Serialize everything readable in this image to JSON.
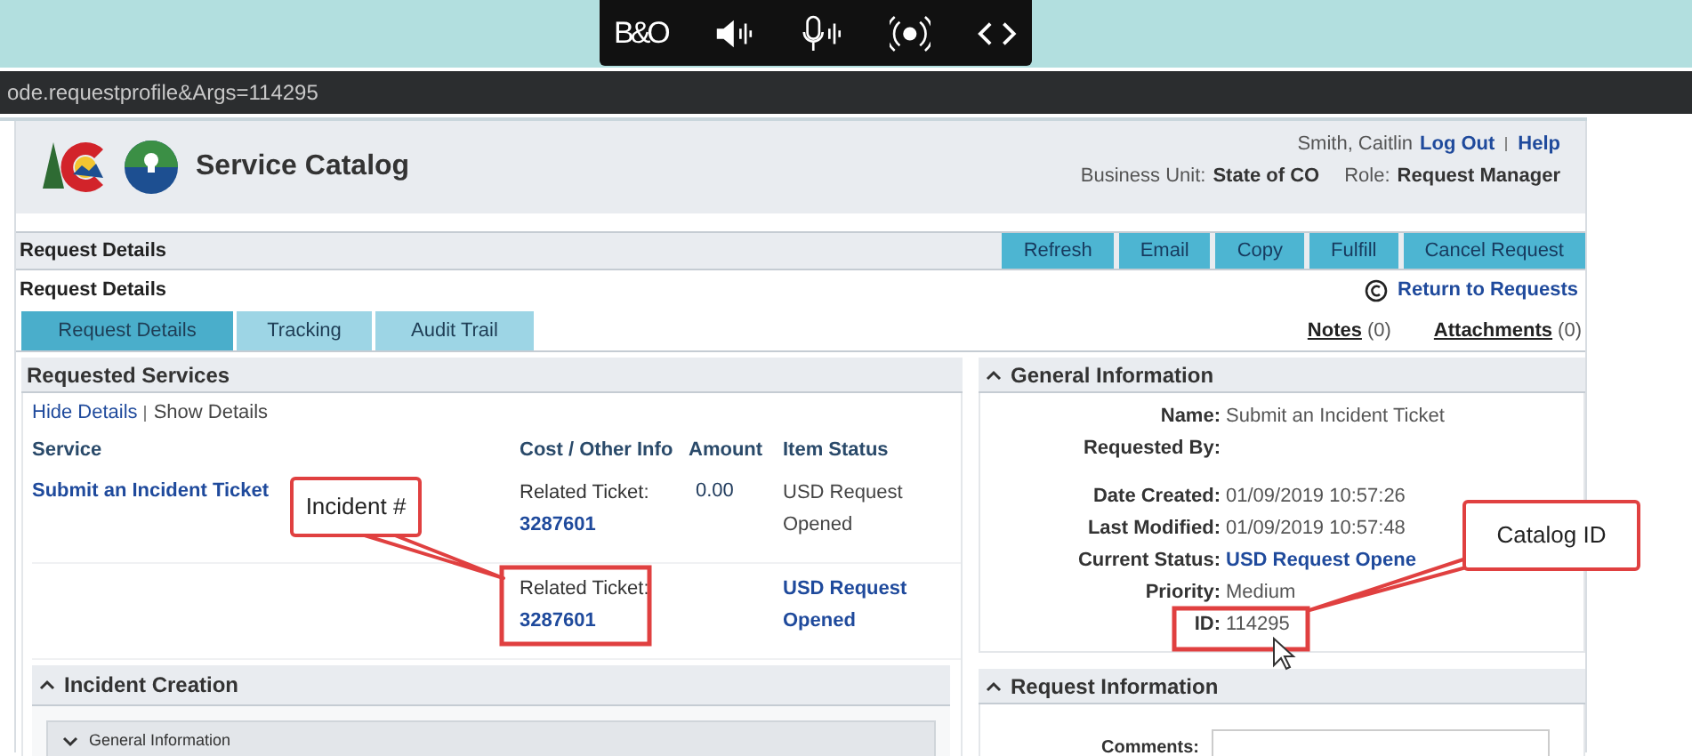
{
  "browser": {
    "toolbar_logo": "B&O",
    "url": "ode.requestprofile&Args=114295"
  },
  "header": {
    "title": "Service Catalog",
    "user": "Smith, Caitlin",
    "links": [
      "Log Out",
      "Help"
    ],
    "business_unit_label": "Business Unit:",
    "business_unit": "State of CO",
    "role_label": "Role:",
    "role": "Request Manager"
  },
  "action_bar": {
    "title": "Request Details",
    "buttons": [
      "Refresh",
      "Email",
      "Copy",
      "Fulfill",
      "Cancel Request"
    ]
  },
  "page_title": "Request Details",
  "return_link": "Return to Requests",
  "tabs": [
    {
      "label": "Request Details",
      "selected": true
    },
    {
      "label": "Tracking",
      "selected": false
    },
    {
      "label": "Audit Trail",
      "selected": false
    }
  ],
  "notes": {
    "label": "Notes",
    "count": "(0)"
  },
  "attachments": {
    "label": "Attachments",
    "count": "(0)"
  },
  "requested_services": {
    "title": "Requested Services",
    "detail_links": [
      "Hide Details",
      "Show Details"
    ],
    "columns": [
      "Service",
      "Cost / Other Info",
      "Amount",
      "Item Status"
    ],
    "rows": [
      {
        "service": "Submit an Incident Ticket",
        "info_label": "Related Ticket:",
        "ticket": "3287601",
        "amount": "0.00",
        "status": "USD Request Opened",
        "kind": "text"
      },
      {
        "info_label": "Related Ticket:",
        "ticket": "3287601",
        "status": "USD Request Opened",
        "kind": "link"
      }
    ]
  },
  "incident_creation": {
    "title": "Incident Creation",
    "sections": [
      {
        "title": "General Information"
      }
    ]
  },
  "general_information": {
    "title": "General Information",
    "field_groups": [
      [
        {
          "label": "Name:",
          "value": "Submit an Incident Ticket",
          "kind": "text"
        },
        {
          "label": "Requested By:"
        }
      ],
      [
        {
          "label": "Date Created:",
          "value": "01/09/2019 10:57:26",
          "kind": "text"
        },
        {
          "label": "Last Modified:",
          "value": "01/09/2019 10:57:48",
          "kind": "text"
        },
        {
          "label": "Current Status:",
          "value": "USD Request Opene",
          "kind": "link"
        },
        {
          "label": "Priority:",
          "value": "Medium",
          "kind": "text"
        },
        {
          "label": "ID:",
          "value": "114295",
          "kind": "text"
        }
      ]
    ]
  },
  "request_information": {
    "title": "Request Information",
    "fields": [
      {
        "label": "Comments:"
      }
    ]
  },
  "annotations": [
    {
      "text": "Incident #"
    },
    {
      "text": "Catalog ID"
    }
  ]
}
